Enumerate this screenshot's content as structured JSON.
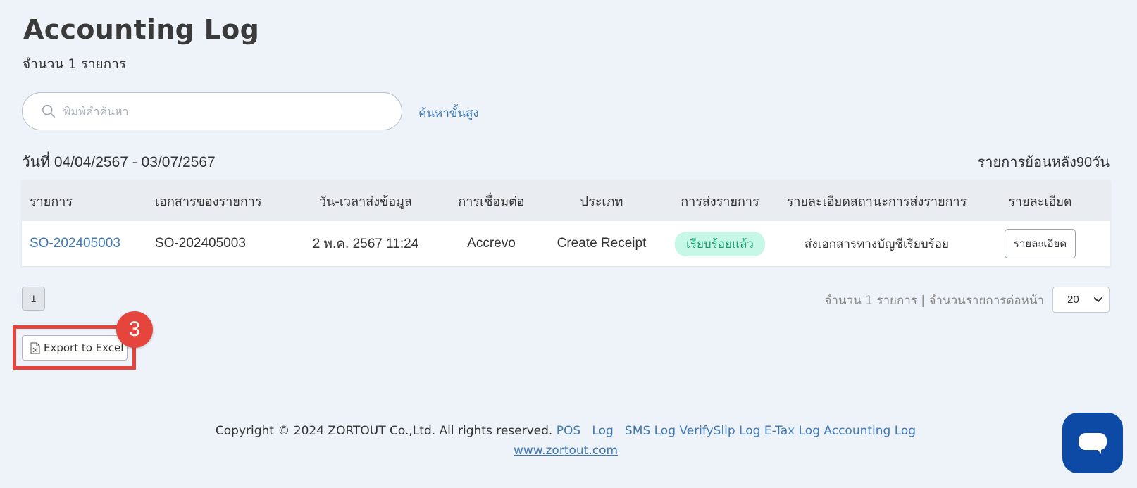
{
  "header": {
    "title": "Accounting Log",
    "count_text": "จำนวน 1 รายการ"
  },
  "search": {
    "placeholder": "พิมพ์คำค้นหา",
    "advanced_label": "ค้นหาขั้นสูง"
  },
  "filter": {
    "date_range": "วันที่ 04/04/2567 - 03/07/2567",
    "history_note": "รายการย้อนหลัง90วัน"
  },
  "table": {
    "headers": [
      "รายการ",
      "เอกสารของรายการ",
      "วัน-เวลาส่งข้อมูล",
      "การเชื่อมต่อ",
      "ประเภท",
      "การส่งรายการ",
      "รายละเอียดสถานะการส่งรายการ",
      "รายละเอียด"
    ],
    "rows": [
      {
        "order": "SO-202405003",
        "document": "SO-202405003",
        "datetime": "2 พ.ค. 2567 11:24",
        "connection": "Accrevo",
        "type": "Create Receipt",
        "status": "เรียบร้อยแล้ว",
        "status_detail": "ส่งเอกสารทางบัญชีเรียบร้อย",
        "detail_button": "รายละเอียด"
      }
    ]
  },
  "pagination": {
    "current_page": "1",
    "info": "จำนวน 1 รายการ | จำนวนรายการต่อหน้า",
    "page_size": "20"
  },
  "export": {
    "label": "Export to Excel",
    "step_number": "3"
  },
  "footer": {
    "copyright": "Copyright © 2024 ZORTOUT Co.,Ltd. All rights reserved.",
    "links": [
      "POS",
      "Log",
      "SMS Log",
      "VerifySlip Log",
      "E-Tax Log",
      "Accounting Log"
    ],
    "website": "www.zortout.com"
  },
  "colors": {
    "accent_link": "#3f79b4",
    "highlight": "#e5453c",
    "status_bg": "#c7f7e6",
    "status_text": "#1b9d73",
    "chat_button": "#0c4aa6"
  }
}
